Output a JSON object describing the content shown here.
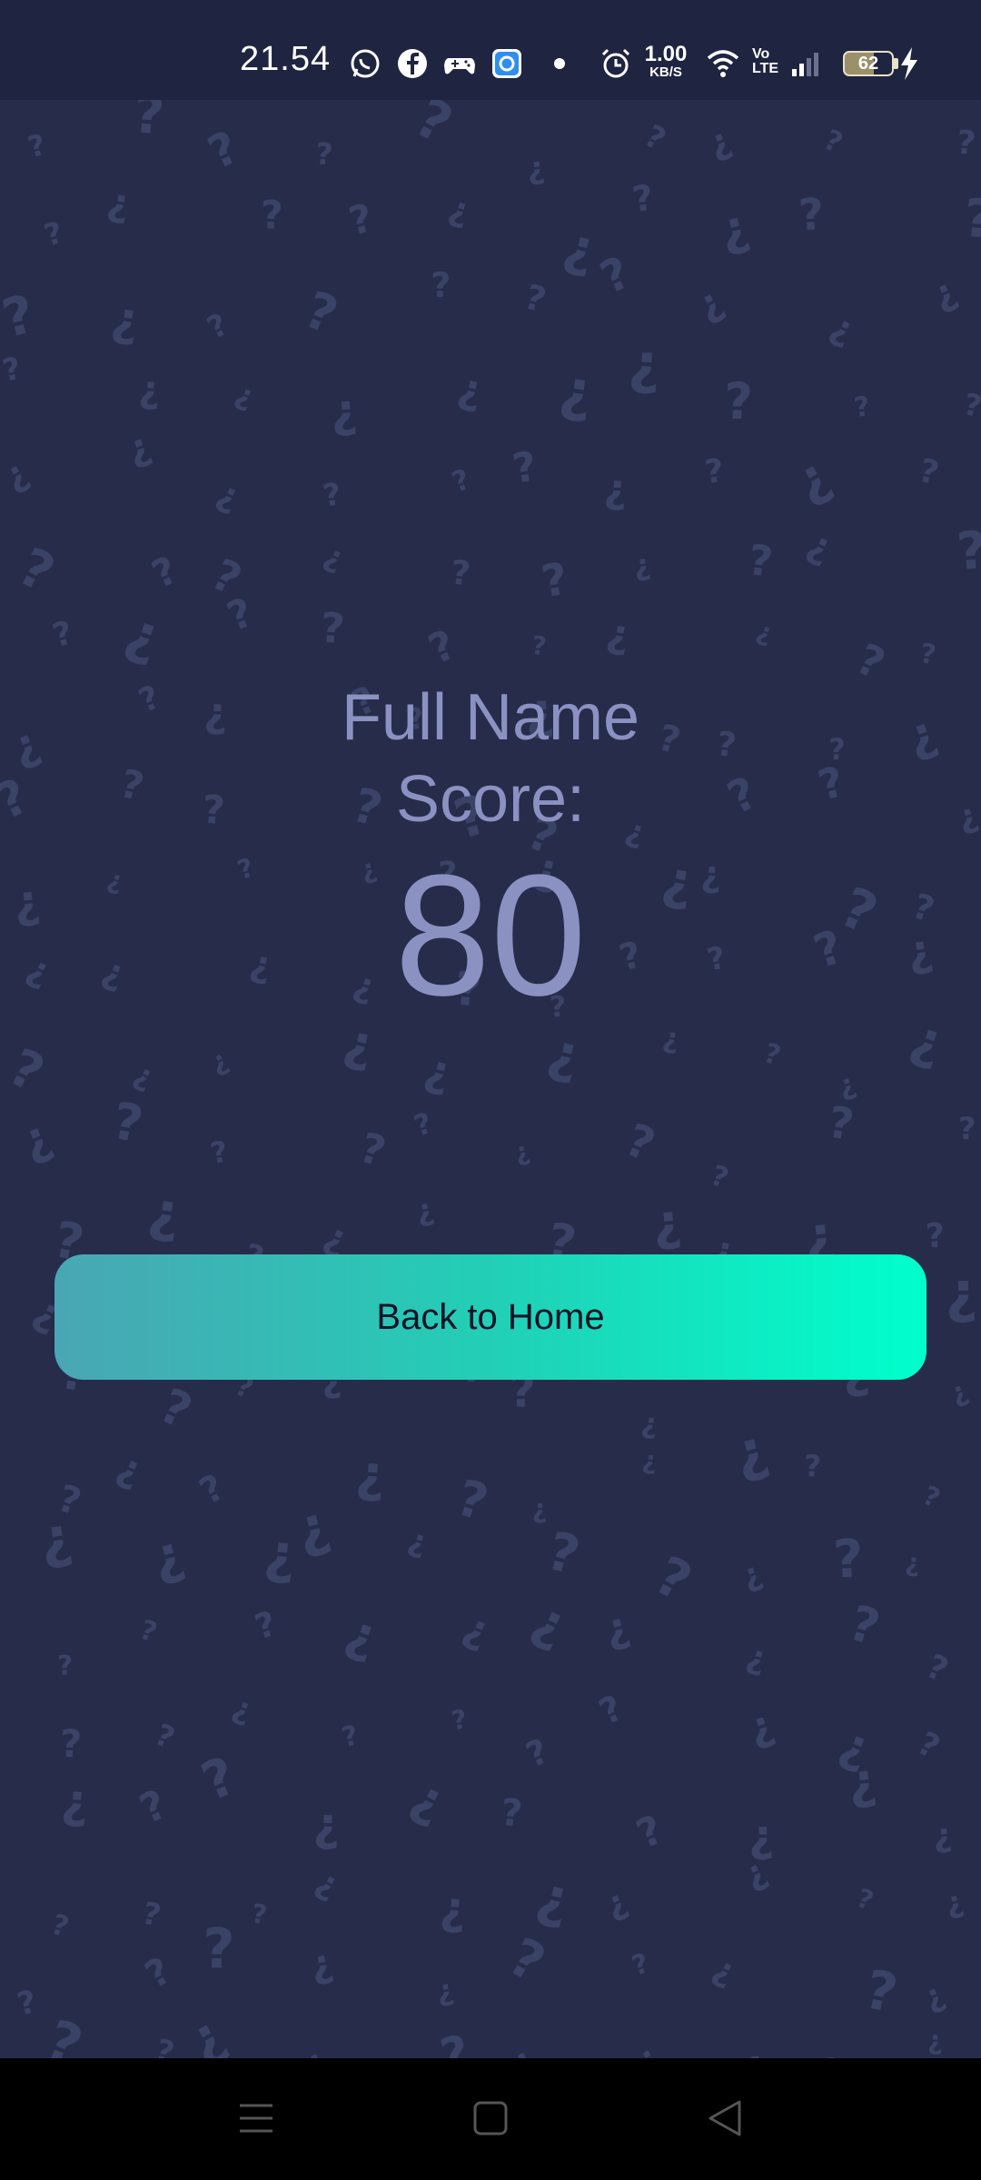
{
  "status_bar": {
    "time": "21.54",
    "net_speed_value": "1.00",
    "net_speed_unit": "KB/S",
    "volte_top": "Vo",
    "volte_bottom": "LTE",
    "battery_level": "62",
    "icons": [
      "whatsapp-icon",
      "facebook-icon",
      "game-controller-icon",
      "app-notification-icon",
      "notification-dot",
      "alarm-icon",
      "wifi-icon",
      "signal-icon",
      "battery-icon",
      "charging-bolt-icon"
    ]
  },
  "score": {
    "title_line1": "Full Name",
    "title_line2": "Score:",
    "value": "80"
  },
  "button": {
    "label": "Back to Home"
  },
  "nav_bar": {
    "icons": [
      "menu-icon",
      "home-icon",
      "back-icon"
    ]
  },
  "colors": {
    "background": "#262c4a",
    "text_muted": "#8b92c2",
    "button_gradient_start": "#4aa6b4",
    "button_gradient_end": "#00ffcc"
  }
}
